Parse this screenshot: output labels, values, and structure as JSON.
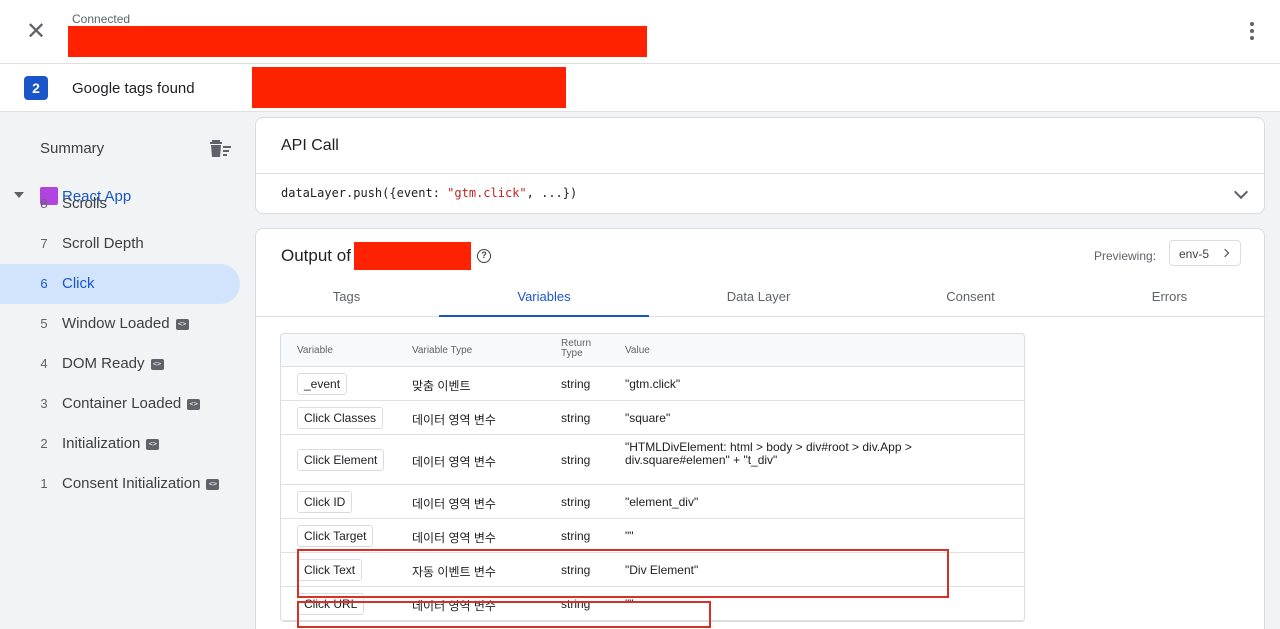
{
  "topbar": {
    "close_icon": "close-icon",
    "status": "Connected",
    "menu_icon": "more-vert-icon"
  },
  "tagsbar": {
    "count": "2",
    "label": "Google tags found"
  },
  "sidebar": {
    "summary": "Summary",
    "clear_icon": "clear-all-icon",
    "app": {
      "label": "React App",
      "icon_color": "#b144e0"
    },
    "events": [
      {
        "num": "8",
        "label": "Scrolls",
        "code": false,
        "active": false
      },
      {
        "num": "7",
        "label": "Scroll Depth",
        "code": false,
        "active": false
      },
      {
        "num": "6",
        "label": "Click",
        "code": false,
        "active": true
      },
      {
        "num": "5",
        "label": "Window Loaded",
        "code": true,
        "active": false
      },
      {
        "num": "4",
        "label": "DOM Ready",
        "code": true,
        "active": false
      },
      {
        "num": "3",
        "label": "Container Loaded",
        "code": true,
        "active": false
      },
      {
        "num": "2",
        "label": "Initialization",
        "code": true,
        "active": false
      },
      {
        "num": "1",
        "label": "Consent Initialization",
        "code": true,
        "active": false
      }
    ],
    "code_glyph": "<>"
  },
  "api": {
    "title": "API Call",
    "code_prefix": "dataLayer.push({event: ",
    "code_string": "\"gtm.click\"",
    "code_suffix": ", ...})"
  },
  "output": {
    "title": "Output of",
    "help_glyph": "?",
    "previewing_label": "Previewing:",
    "env": "env-5",
    "tabs": [
      {
        "label": "Tags",
        "active": false
      },
      {
        "label": "Variables",
        "active": true
      },
      {
        "label": "Data Layer",
        "active": false
      },
      {
        "label": "Consent",
        "active": false
      },
      {
        "label": "Errors",
        "active": false
      }
    ]
  },
  "variables": {
    "headers": {
      "variable": "Variable",
      "type": "Variable Type",
      "return": "Return Type",
      "value": "Value"
    },
    "rows": [
      {
        "name": "_event",
        "type": "맞춤 이벤트",
        "ret": "string",
        "value": "\"gtm.click\""
      },
      {
        "name": "Click Classes",
        "type": "데이터 영역 변수",
        "ret": "string",
        "value": "\"square\""
      },
      {
        "name": "Click Element",
        "type": "데이터 영역 변수",
        "ret": "string",
        "value": "\"HTMLDivElement: html > body > div#root > div.App > div.square#elemen\" + \"t_div\""
      },
      {
        "name": "Click ID",
        "type": "데이터 영역 변수",
        "ret": "string",
        "value": "\"element_div\""
      },
      {
        "name": "Click Target",
        "type": "데이터 영역 변수",
        "ret": "string",
        "value": "\"\""
      },
      {
        "name": "Click Text",
        "type": "자동 이벤트 변수",
        "ret": "string",
        "value": "\"Div Element\""
      },
      {
        "name": "Click URL",
        "type": "데이터 영역 변수",
        "ret": "string",
        "value": "\"\""
      }
    ]
  },
  "colors": {
    "accent": "#1a56c9",
    "redaction": "#ff2200",
    "highlight": "#d93025"
  }
}
